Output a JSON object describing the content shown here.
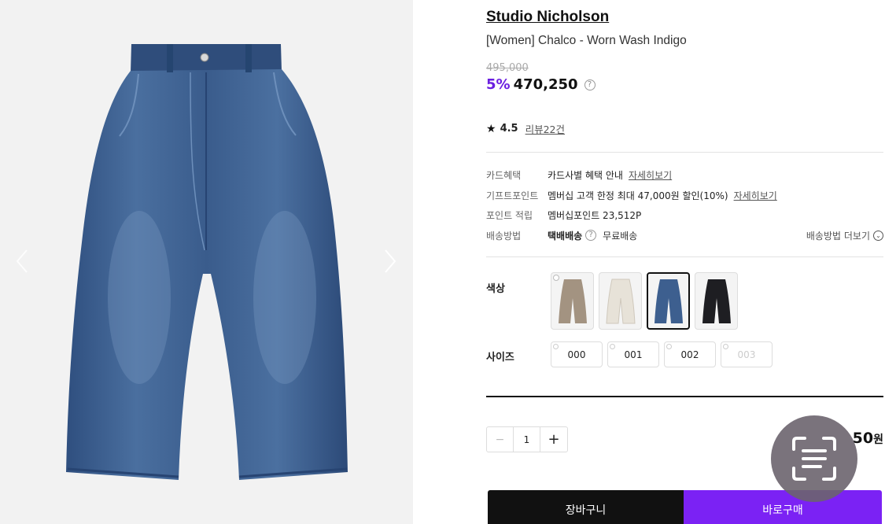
{
  "product": {
    "brand": "Studio Nicholson",
    "name": "[Women] Chalco - Worn Wash Indigo",
    "original_price": "495,000",
    "discount": "5%",
    "price": "470,250",
    "help_icon": "?"
  },
  "rating": {
    "star_icon": "★",
    "value": "4.5",
    "review_link": "리뷰22건"
  },
  "benefits": {
    "card_label": "카드혜택",
    "card_value": "카드사별 혜택 안내",
    "card_link": "자세히보기",
    "gift_label": "기프트포인트",
    "gift_value": "멤버십 고객 한정 최대 47,000원 할인(10%)",
    "gift_link": "자세히보기",
    "point_label": "포인트 적립",
    "point_value": "멤버십포인트 23,512P",
    "ship_label": "배송방법",
    "ship_method": "택배배송",
    "ship_help": "?",
    "ship_free": "무료배송",
    "ship_more": "배송방법 더보기",
    "ship_more_icon": "⌄"
  },
  "options": {
    "color_label": "색상",
    "size_label": "사이즈",
    "colors": [
      {
        "name": "beige",
        "color": "#a39381",
        "selected": false
      },
      {
        "name": "ecru",
        "color": "#e7e2d8",
        "selected": false
      },
      {
        "name": "indigo",
        "color": "#3d5f8f",
        "selected": true
      },
      {
        "name": "black",
        "color": "#1e1e22",
        "selected": false
      }
    ],
    "sizes": [
      {
        "label": "000"
      },
      {
        "label": "001"
      },
      {
        "label": "002"
      },
      {
        "label": "003"
      }
    ]
  },
  "quantity": {
    "minus": "−",
    "count": "1",
    "plus": "+"
  },
  "total": {
    "amount_visible": "50",
    "currency": "원"
  },
  "actions": {
    "cart": "장바구니",
    "buy": "바로구매"
  },
  "colors": {
    "accent": "#7b22f4",
    "discount": "#6b1fe0",
    "denim": "#3d5f8f"
  }
}
